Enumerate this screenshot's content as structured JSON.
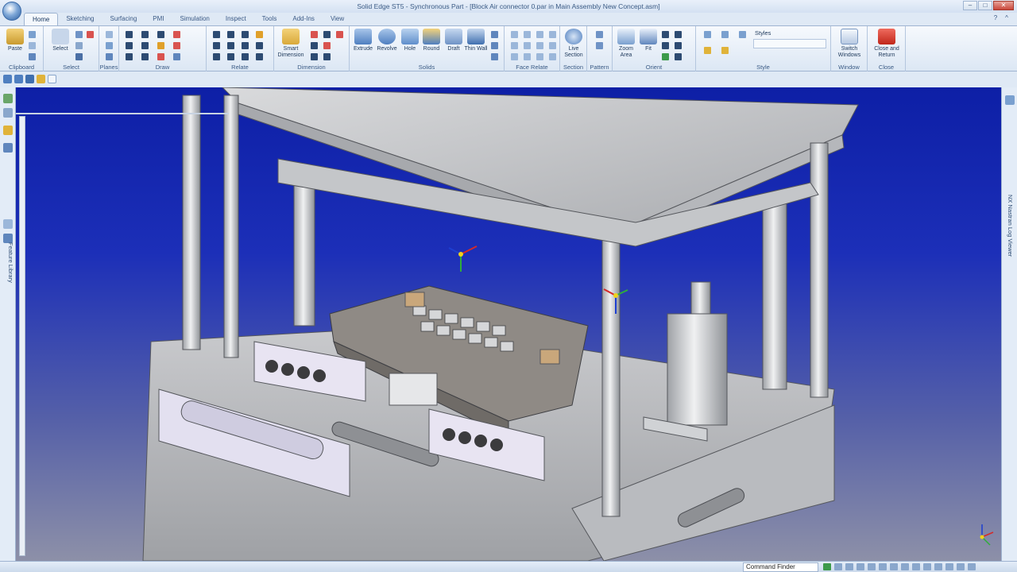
{
  "window": {
    "title": "Solid Edge ST5 - Synchronous Part - [Block Air connector 0.par in Main Assembly New Concept.asm]",
    "controls": [
      "–",
      "□",
      "✕"
    ]
  },
  "tabs": [
    "Home",
    "Sketching",
    "Surfacing",
    "PMI",
    "Simulation",
    "Inspect",
    "Tools",
    "Add-Ins",
    "View"
  ],
  "ribbon": {
    "groups": [
      "Clipboard",
      "Select",
      "Planes",
      "Draw",
      "Relate",
      "Dimension",
      "Solids",
      "Face Relate",
      "Section",
      "Pattern",
      "Orient",
      "Style",
      "Window",
      "Close"
    ],
    "buttons": {
      "paste": "Paste",
      "select": "Select",
      "smart_dimension": "Smart Dimension",
      "extrude": "Extrude",
      "revolve": "Revolve",
      "hole": "Hole",
      "round": "Round",
      "draft": "Draft",
      "thin_wall": "Thin Wall",
      "live_section": "Live Section",
      "zoom_area": "Zoom Area",
      "fit": "Fit",
      "styles": "Styles",
      "switch_windows": "Switch Windows",
      "close_return": "Close and Return"
    }
  },
  "side": {
    "feature_library": "Feature Library",
    "nastran": "NX Nastran Log Viewer"
  },
  "status": {
    "command_finder": "Command Finder"
  },
  "colors": {
    "viewport_top": "#0d1fa6",
    "viewport_bottom": "#8d90a8",
    "accent": "#d9534f"
  }
}
